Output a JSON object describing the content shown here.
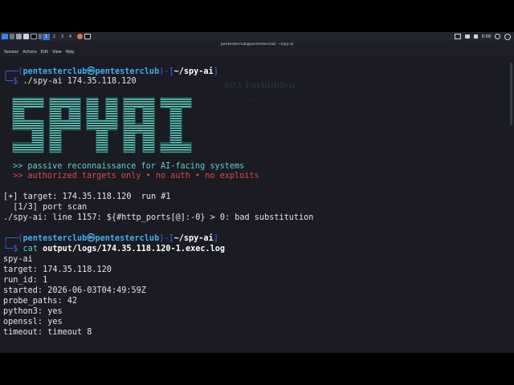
{
  "panel": {
    "workspaces": [
      "1",
      "2",
      "3",
      "4"
    ],
    "clock": "0:58"
  },
  "window": {
    "title": "pentesterclub@pentesterclub: ~/spy-ai",
    "menu": [
      "Session",
      "Actions",
      "Edit",
      "View",
      "Help"
    ]
  },
  "background_page": {
    "heading": "403 Forbidden",
    "subtext": "nginx"
  },
  "prompt": {
    "open": "┌──(",
    "user": "pentesterclub",
    "at": "㉿",
    "host": "pentesterclub",
    "mid": ")-[",
    "path": "~/spy-ai",
    "close": "]",
    "prefix": "└─$ "
  },
  "command1": "./spy-ai 174.35.118.120",
  "banner_text": "SPYAI",
  "tagline1": ">> passive reconnaissance for AI-facing systems",
  "tagline2": ">> authorized targets only • no auth • no exploits",
  "output1": [
    "[+] target: 174.35.118.120  run #1",
    "  [1/3] port scan",
    "./spy-ai: line 1157: ${#http_ports[@]:-0} > 0: bad substitution"
  ],
  "command2": {
    "cmd": "cat",
    "arg": "output/logs/174.35.118.120-1.exec.log"
  },
  "output2": [
    "spy-ai",
    "target: 174.35.118.120",
    "run_id: 1",
    "started: 2026-06-03T04:49:59Z",
    "probe_paths: 42",
    "python3: yes",
    "openssl: yes",
    "timeout: timeout 8"
  ],
  "colors": {
    "prompt_frame": "#3d6bf2",
    "prompt_user": "#3fb0f0",
    "banner": "#5fd3c3",
    "tagline_ok": "#5fd3c3",
    "tagline_warn": "#e2474a",
    "terminal_bg": "#1a1b23"
  }
}
